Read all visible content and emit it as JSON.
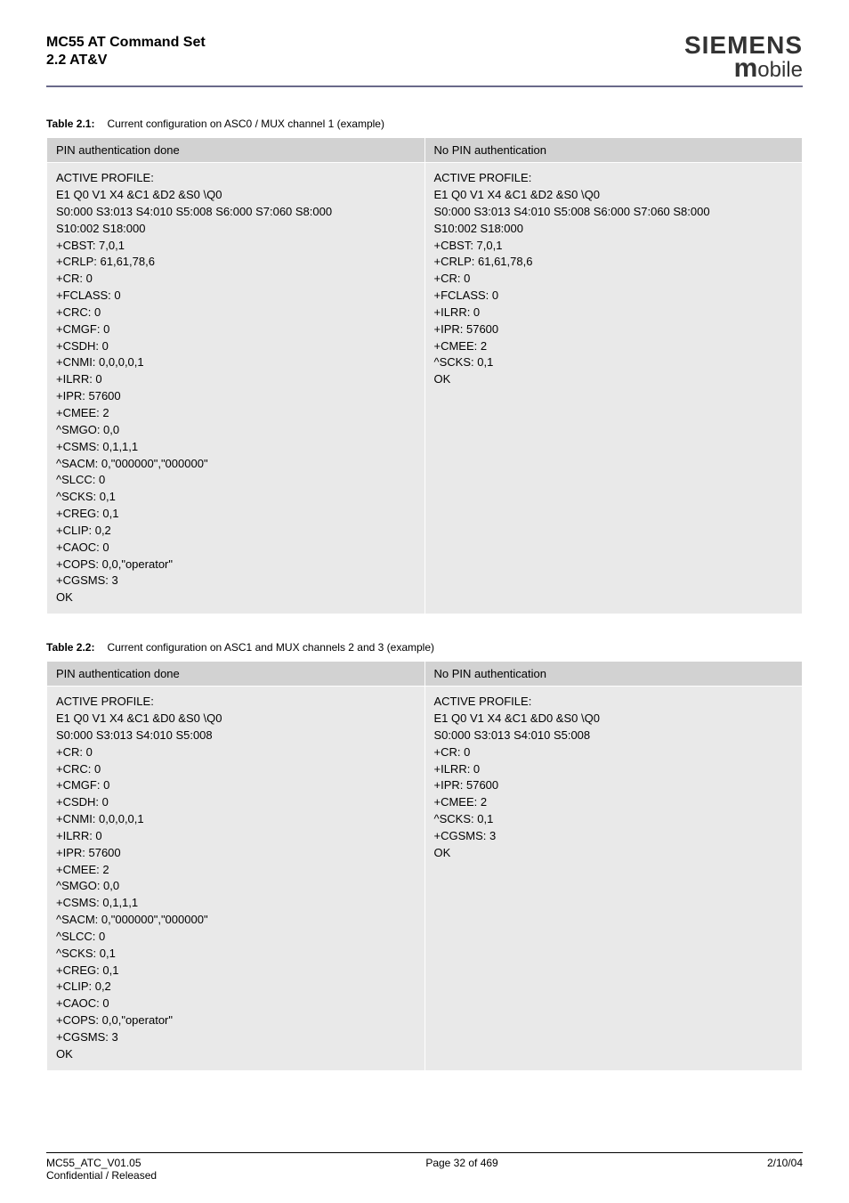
{
  "header": {
    "title": "MC55 AT Command Set",
    "subtitle": "2.2 AT&V",
    "brand_top": "SIEMENS",
    "brand_bottom_m": "m",
    "brand_bottom_rest": "obile"
  },
  "table1": {
    "label": "Table 2.1:",
    "caption": "Current configuration on ASC0 / MUX channel 1 (example)",
    "head_left": "PIN authentication done",
    "head_right": "No PIN authentication",
    "cell_left": "ACTIVE PROFILE:\nE1 Q0 V1 X4 &C1 &D2 &S0 \\Q0\nS0:000 S3:013 S4:010 S5:008 S6:000 S7:060 S8:000\nS10:002 S18:000\n+CBST: 7,0,1\n+CRLP: 61,61,78,6\n+CR: 0\n+FCLASS: 0\n+CRC: 0\n+CMGF: 0\n+CSDH: 0\n+CNMI: 0,0,0,0,1\n+ILRR: 0\n+IPR: 57600\n+CMEE: 2\n^SMGO: 0,0\n+CSMS: 0,1,1,1\n^SACM: 0,\"000000\",\"000000\"\n^SLCC: 0\n^SCKS: 0,1\n+CREG: 0,1\n+CLIP: 0,2\n+CAOC: 0\n+COPS: 0,0,\"operator\"\n+CGSMS: 3\nOK",
    "cell_right": "ACTIVE PROFILE:\nE1 Q0 V1 X4 &C1 &D2 &S0 \\Q0\nS0:000 S3:013 S4:010 S5:008 S6:000 S7:060 S8:000\nS10:002 S18:000\n+CBST: 7,0,1\n+CRLP: 61,61,78,6\n+CR: 0\n+FCLASS: 0\n+ILRR: 0\n+IPR: 57600\n+CMEE: 2\n^SCKS: 0,1\nOK"
  },
  "table2": {
    "label": "Table 2.2:",
    "caption": "Current configuration on ASC1 and MUX channels 2 and 3 (example)",
    "head_left": "PIN authentication done",
    "head_right": "No PIN authentication",
    "cell_left": "ACTIVE PROFILE:\nE1 Q0 V1 X4 &C1 &D0 &S0 \\Q0\nS0:000 S3:013 S4:010 S5:008\n+CR: 0\n+CRC: 0\n+CMGF: 0\n+CSDH: 0\n+CNMI: 0,0,0,0,1\n+ILRR: 0\n+IPR: 57600\n+CMEE: 2\n^SMGO: 0,0\n+CSMS: 0,1,1,1\n^SACM: 0,\"000000\",\"000000\"\n^SLCC: 0\n^SCKS: 0,1\n+CREG: 0,1\n+CLIP: 0,2\n+CAOC: 0\n+COPS: 0,0,\"operator\"\n+CGSMS: 3\nOK",
    "cell_right": "ACTIVE PROFILE:\nE1 Q0 V1 X4 &C1 &D0 &S0 \\Q0\nS0:000 S3:013 S4:010 S5:008\n+CR: 0\n+ILRR: 0\n+IPR: 57600\n+CMEE: 2\n^SCKS: 0,1\n+CGSMS: 3\nOK"
  },
  "footer": {
    "left_line1": "MC55_ATC_V01.05",
    "left_line2": "Confidential / Released",
    "center": "Page 32 of 469",
    "right": "2/10/04"
  }
}
